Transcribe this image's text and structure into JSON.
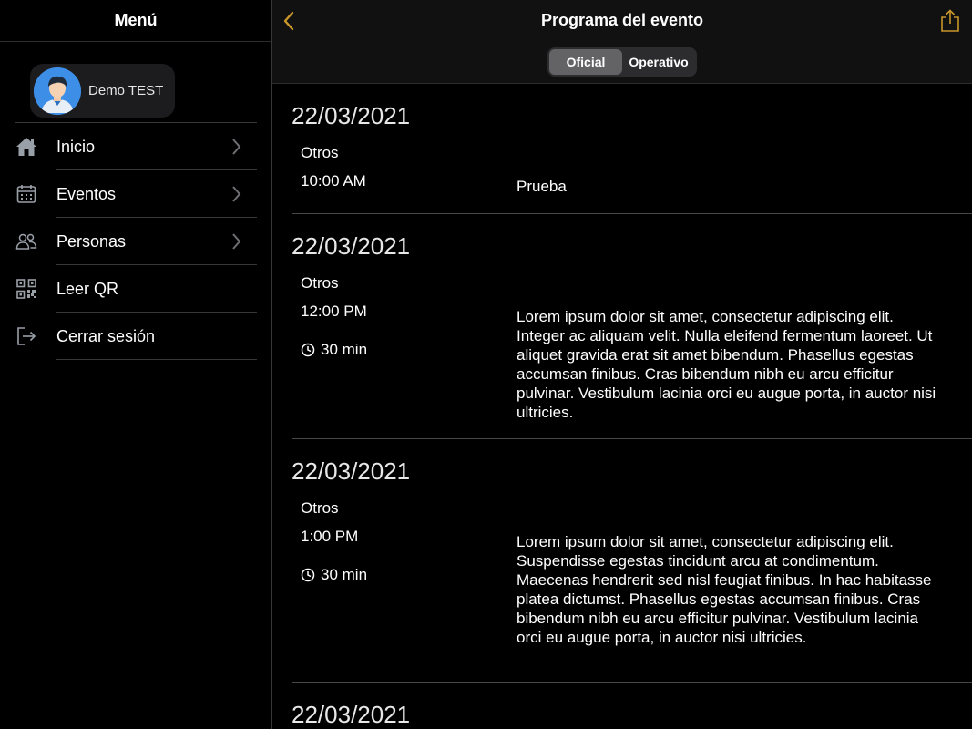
{
  "sidebar": {
    "title": "Menú",
    "profile": {
      "name": "Demo TEST"
    },
    "items": [
      {
        "label": "Inicio",
        "icon": "home-icon",
        "chevron": true
      },
      {
        "label": "Eventos",
        "icon": "calendar-icon",
        "chevron": true
      },
      {
        "label": "Personas",
        "icon": "people-icon",
        "chevron": true
      },
      {
        "label": "Leer QR",
        "icon": "qr-code-icon",
        "chevron": false
      },
      {
        "label": "Cerrar sesión",
        "icon": "logout-icon",
        "chevron": false
      }
    ]
  },
  "header": {
    "title": "Programa del evento",
    "segments": [
      "Oficial",
      "Operativo"
    ],
    "active_segment": "Oficial"
  },
  "colors": {
    "accent": "#c8962a",
    "background": "#000000",
    "selected_segment": "#636366"
  },
  "events": [
    {
      "date": "22/03/2021",
      "category": "Otros",
      "time": "10:00 AM",
      "duration": "",
      "description": "Prueba"
    },
    {
      "date": "22/03/2021",
      "category": "Otros",
      "time": "12:00 PM",
      "duration": "30 min",
      "description": "Lorem ipsum dolor sit amet, consectetur adipiscing elit. Integer ac aliquam velit. Nulla eleifend fermentum laoreet. Ut aliquet gravida erat sit amet bibendum. Phasellus egestas accumsan finibus. Cras bibendum nibh eu arcu efficitur pulvinar. Vestibulum lacinia orci eu augue porta, in auctor nisi ultricies."
    },
    {
      "date": "22/03/2021",
      "category": "Otros",
      "time": "1:00 PM",
      "duration": "30 min",
      "description": "Lorem ipsum dolor sit amet, consectetur adipiscing elit. Suspendisse egestas tincidunt arcu at condimentum. Maecenas hendrerit sed nisl feugiat finibus. In hac habitasse platea dictumst. Phasellus egestas accumsan finibus. Cras bibendum nibh eu arcu efficitur pulvinar. Vestibulum lacinia orci eu augue porta, in auctor nisi ultricies."
    },
    {
      "date": "22/03/2021",
      "category": "",
      "time": "",
      "duration": "",
      "description": ""
    }
  ]
}
